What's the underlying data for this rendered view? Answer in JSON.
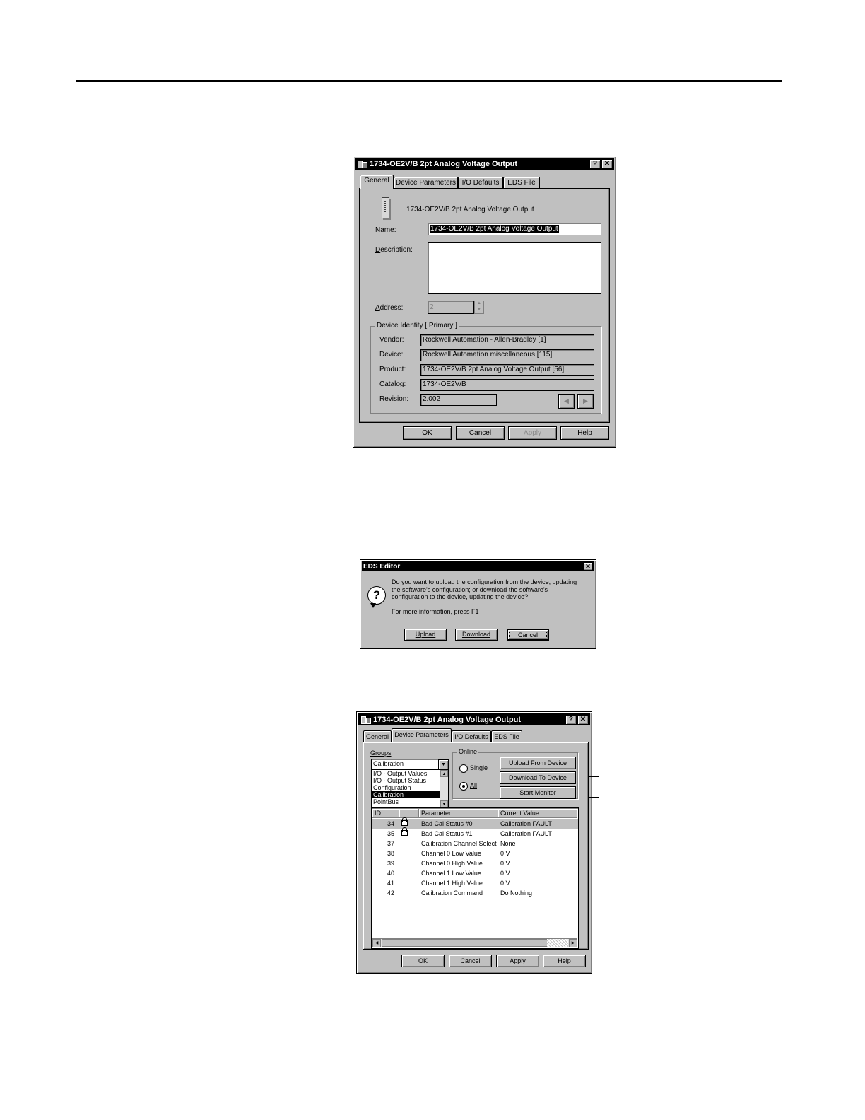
{
  "dialog1": {
    "title": "1734-OE2V/B 2pt Analog Voltage Output",
    "help_btn": "?",
    "close_btn": "✕",
    "tabs": [
      "General",
      "Device Parameters",
      "I/O Defaults",
      "EDS File"
    ],
    "device_name_heading": "1734-OE2V/B 2pt Analog Voltage Output",
    "name_label": "Name:",
    "name_value": "1734-OE2V/B 2pt Analog Voltage Output",
    "description_label": "Description:",
    "description_value": "",
    "address_label": "Address:",
    "address_value": "2",
    "identity_group": "Device Identity [ Primary ]",
    "identity": [
      {
        "label": "Vendor:",
        "value": "Rockwell Automation - Allen-Bradley [1]"
      },
      {
        "label": "Device:",
        "value": "Rockwell Automation miscellaneous [115]"
      },
      {
        "label": "Product:",
        "value": "1734-OE2V/B 2pt Analog Voltage Output [56]"
      },
      {
        "label": "Catalog:",
        "value": "1734-OE2V/B"
      },
      {
        "label": "Revision:",
        "value": "2.002"
      }
    ],
    "buttons": {
      "ok": "OK",
      "cancel": "Cancel",
      "apply": "Apply",
      "help": "Help"
    }
  },
  "dialog2": {
    "title": "EDS Editor",
    "close_btn": "✕",
    "message": "Do you want to upload the configuration from the device, updating the software's configuration; or download the software's configuration to the device, updating the device?",
    "more_info": "For more information, press F1",
    "buttons": {
      "upload": "Upload",
      "download": "Download",
      "cancel": "Cancel"
    }
  },
  "dialog3": {
    "title": "1734-OE2V/B 2pt Analog Voltage Output",
    "help_btn": "?",
    "close_btn": "✕",
    "tabs": [
      "General",
      "Device Parameters",
      "I/O Defaults",
      "EDS File"
    ],
    "groups_label": "Groups",
    "groups_selected": "Calibration",
    "groups_options": [
      "I/O - Output Values",
      "I/O - Output Status",
      "Configuration",
      "Calibration",
      "PointBus"
    ],
    "online_group": "Online",
    "single_label": "Single",
    "all_label": "All",
    "upload_btn": "Upload From Device",
    "download_btn": "Download To Device",
    "monitor_btn": "Start Monitor",
    "columns": {
      "id": "ID",
      "param": "Parameter",
      "value": "Current Value"
    },
    "rows": [
      {
        "id": "34",
        "locked": true,
        "param": "Bad Cal Status #0",
        "value": "Calibration FAULT"
      },
      {
        "id": "35",
        "locked": true,
        "param": "Bad Cal Status #1",
        "value": "Calibration FAULT"
      },
      {
        "id": "37",
        "locked": false,
        "param": "Calibration Channel Select",
        "value": "None"
      },
      {
        "id": "38",
        "locked": false,
        "param": "Channel 0 Low Value",
        "value": "0 V"
      },
      {
        "id": "39",
        "locked": false,
        "param": "Channel 0 High Value",
        "value": "0 V"
      },
      {
        "id": "40",
        "locked": false,
        "param": "Channel 1 Low Value",
        "value": "0 V"
      },
      {
        "id": "41",
        "locked": false,
        "param": "Channel 1 High Value",
        "value": "0 V"
      },
      {
        "id": "42",
        "locked": false,
        "param": "Calibration Command",
        "value": "Do Nothing"
      }
    ],
    "buttons": {
      "ok": "OK",
      "cancel": "Cancel",
      "apply": "Apply",
      "help": "Help"
    }
  }
}
